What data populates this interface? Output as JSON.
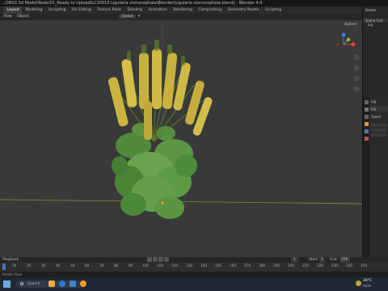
{
  "window": {
    "title": "...ONV2.3d Model\\Reda\\01_Ready to Upload\\LC20018 Ligularia stenocephala\\Blender\\Ligularia stenocephala.blend] - Blender 4.0"
  },
  "workspaces": [
    "Layout",
    "Modeling",
    "Sculpting",
    "UV Editing",
    "Texture Paint",
    "Shading",
    "Animation",
    "Rendering",
    "Compositing",
    "Geometry Nodes",
    "Scripting"
  ],
  "active_workspace": "Layout",
  "viewport_header": {
    "mode_items": [
      "View",
      "Object"
    ],
    "orientation": "Global"
  },
  "outliner": {
    "label": "Scene",
    "options": "Options",
    "rows": [
      "Scene Coll",
      "Lig"
    ]
  },
  "properties": {
    "rows": [
      "Lig",
      "Lig",
      "Transf"
    ]
  },
  "timeline": {
    "header": "Playback",
    "frame_current": "1",
    "start_label": "Start",
    "start": "1",
    "end_label": "End",
    "end": "250",
    "ticks": [
      "10",
      "20",
      "30",
      "40",
      "50",
      "60",
      "70",
      "80",
      "90",
      "100",
      "110",
      "120",
      "130",
      "140",
      "150",
      "160",
      "170",
      "180",
      "190",
      "200",
      "210",
      "220",
      "230",
      "240",
      "250"
    ]
  },
  "status": {
    "left": "Rotate View"
  },
  "taskbar": {
    "search": "Search",
    "temp": "28°C",
    "weather": "Haze"
  },
  "colors": {
    "viewport": "#393939",
    "accent": "#4772b3"
  }
}
